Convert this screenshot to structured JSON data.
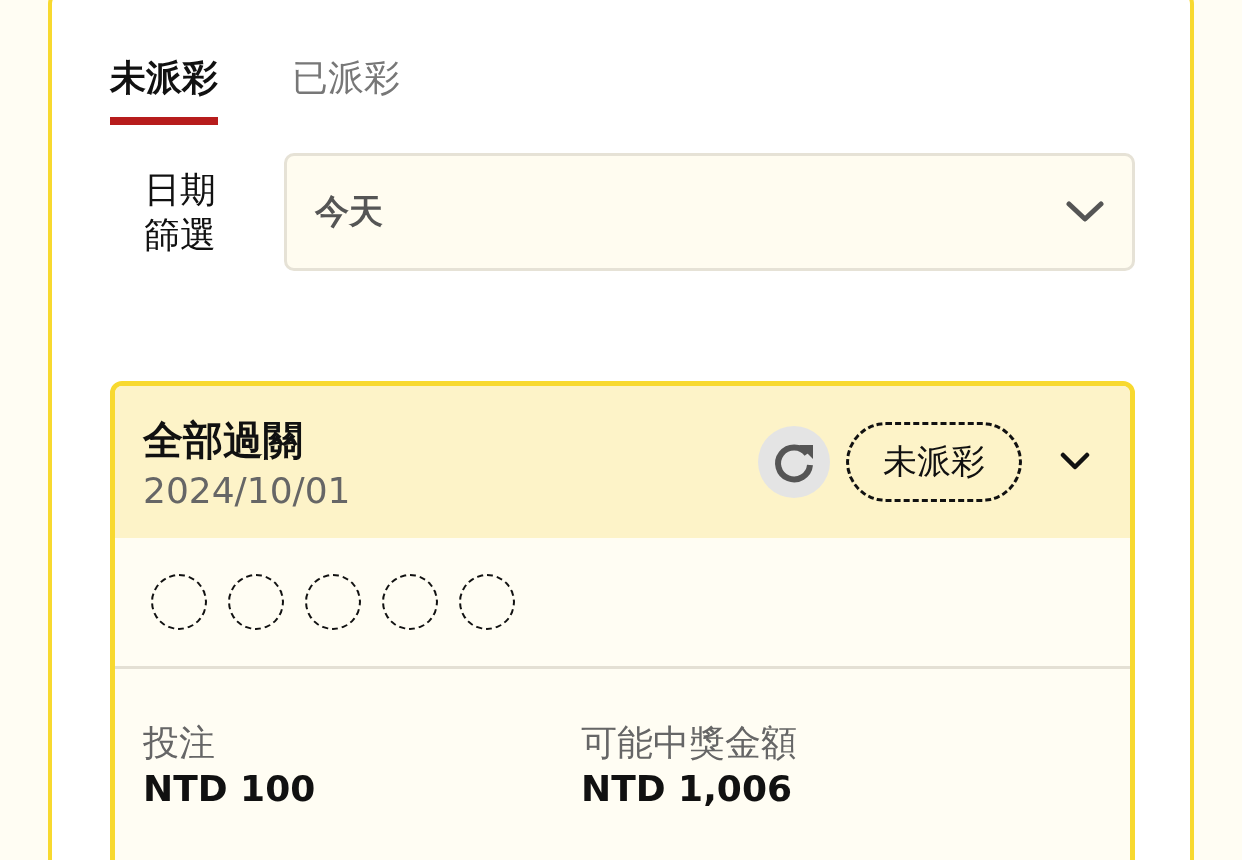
{
  "tabs": [
    {
      "label": "未派彩",
      "selected": true
    },
    {
      "label": "已派彩",
      "selected": false
    }
  ],
  "date_filter": {
    "label": "日期篩選",
    "value": "今天"
  },
  "bet_card": {
    "title": "全部過關",
    "date": "2024/10/01",
    "status": "未派彩",
    "slots": [
      {
        "filled": false
      },
      {
        "filled": false
      },
      {
        "filled": false
      },
      {
        "filled": false
      },
      {
        "filled": false
      }
    ],
    "stats": [
      {
        "label": "投注",
        "value": "NTD 100"
      },
      {
        "label": "可能中獎金額",
        "value": "NTD 1,006"
      }
    ]
  }
}
